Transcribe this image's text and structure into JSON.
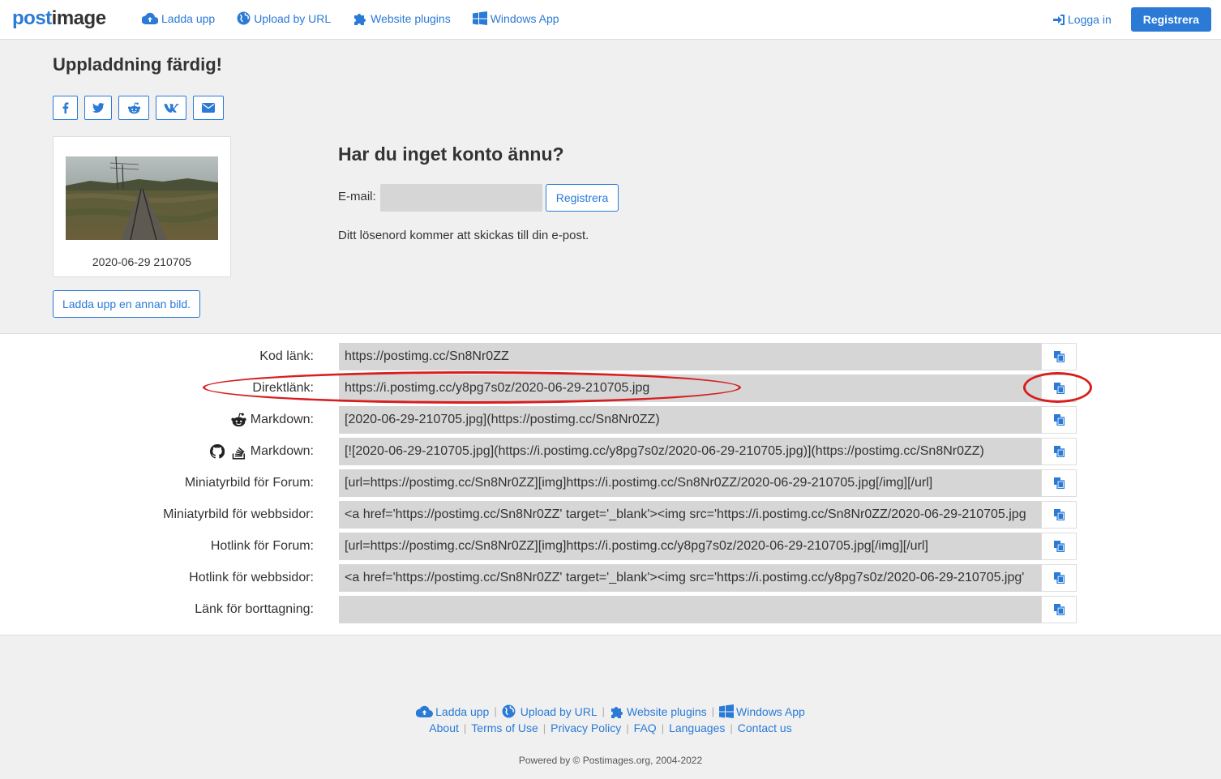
{
  "navbar": {
    "brand_part1": "post",
    "brand_part2": "image",
    "links": {
      "upload": "Ladda upp",
      "upload_url": "Upload by URL",
      "plugins": "Website plugins",
      "windows": "Windows App"
    },
    "login": "Logga in",
    "register": "Registrera"
  },
  "upload": {
    "title": "Uppladdning färdig!",
    "thumbnail_caption": "2020-06-29 210705",
    "upload_another": "Ladda upp en annan bild."
  },
  "signup": {
    "title": "Har du inget konto ännu?",
    "email_label": "E-mail:",
    "email_value": "",
    "register_button": "Registrera",
    "note": "Ditt lösenord kommer att skickas till din e-post."
  },
  "links": [
    {
      "label": "Kod länk:",
      "value": "https://postimg.cc/Sn8Nr0ZZ"
    },
    {
      "label": "Direktlänk:",
      "value": "https://i.postimg.cc/y8pg7s0z/2020-06-29-210705.jpg"
    },
    {
      "label": "Markdown:",
      "value": "[2020-06-29-210705.jpg](https://postimg.cc/Sn8Nr0ZZ)"
    },
    {
      "label": "Markdown:",
      "value": "[![2020-06-29-210705.jpg](https://i.postimg.cc/y8pg7s0z/2020-06-29-210705.jpg)](https://postimg.cc/Sn8Nr0ZZ)"
    },
    {
      "label": "Miniatyrbild för Forum:",
      "value": "[url=https://postimg.cc/Sn8Nr0ZZ][img]https://i.postimg.cc/Sn8Nr0ZZ/2020-06-29-210705.jpg[/img][/url]"
    },
    {
      "label": "Miniatyrbild för webbsidor:",
      "value": "<a href='https://postimg.cc/Sn8Nr0ZZ' target='_blank'><img src='https://i.postimg.cc/Sn8Nr0ZZ/2020-06-29-210705.jpg"
    },
    {
      "label": "Hotlink för Forum:",
      "value": "[url=https://postimg.cc/Sn8Nr0ZZ][img]https://i.postimg.cc/y8pg7s0z/2020-06-29-210705.jpg[/img][/url]"
    },
    {
      "label": "Hotlink för webbsidor:",
      "value": "<a href='https://postimg.cc/Sn8Nr0ZZ' target='_blank'><img src='https://i.postimg.cc/y8pg7s0z/2020-06-29-210705.jpg'"
    },
    {
      "label": "Länk för borttagning:",
      "value": ""
    }
  ],
  "footer": {
    "upload": "Ladda upp",
    "upload_url": "Upload by URL",
    "plugins": "Website plugins",
    "windows": "Windows App",
    "about": "About",
    "terms": "Terms of Use",
    "privacy": "Privacy Policy",
    "faq": "FAQ",
    "languages": "Languages",
    "contact": "Contact us",
    "powered": "Powered by © Postimages.org, 2004-2022"
  },
  "colors": {
    "accent": "#2a7ad6",
    "annotation": "#d81e1e",
    "field_bg": "#d6d6d6"
  }
}
